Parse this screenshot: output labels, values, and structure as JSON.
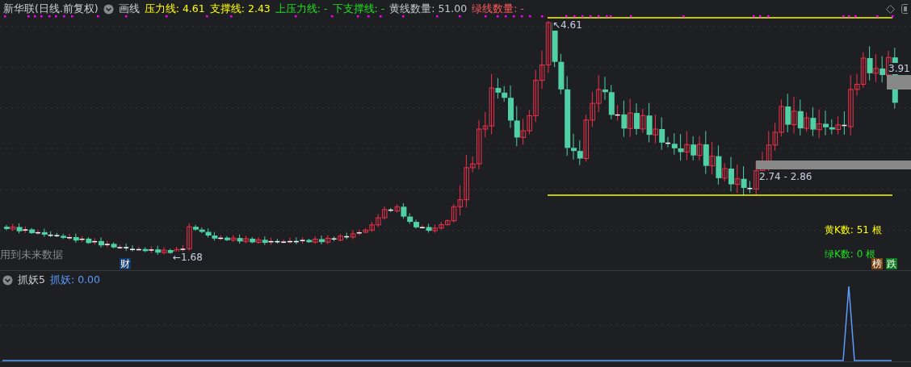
{
  "header": {
    "stock": "新华联(日线.前复权)",
    "draw_button": "画线",
    "indicators": [
      {
        "label": "压力线: 4.61",
        "color": "#ffff00"
      },
      {
        "label": "支撑线: 2.43",
        "color": "#ffff00"
      },
      {
        "label": "上压力线: -",
        "color": "#22dd22"
      },
      {
        "label": "下支撑线: -",
        "color": "#22dd22"
      },
      {
        "label": "黄线数量: 51.00",
        "color": "#c8c8c8"
      },
      {
        "label": "绿线数量: -",
        "color": "#ff5a5a"
      }
    ]
  },
  "main_chart": {
    "high_label": "↖4.61",
    "low_label": "←1.68",
    "right_price": "3.91",
    "zone_label": "2.74 - 2.86",
    "future_data_note": "用到未来数据",
    "finance_marker": "财",
    "yellow_count": "黄K数: 51 根",
    "green_count": "绿K数: 0 根",
    "badges": [
      {
        "text": "榜",
        "color": "#7a4410"
      },
      {
        "text": "跌",
        "color": "#0b7a1e"
      }
    ]
  },
  "sub_pane": {
    "name": "抓妖5",
    "value_label": "抓妖: 0.00"
  }
}
